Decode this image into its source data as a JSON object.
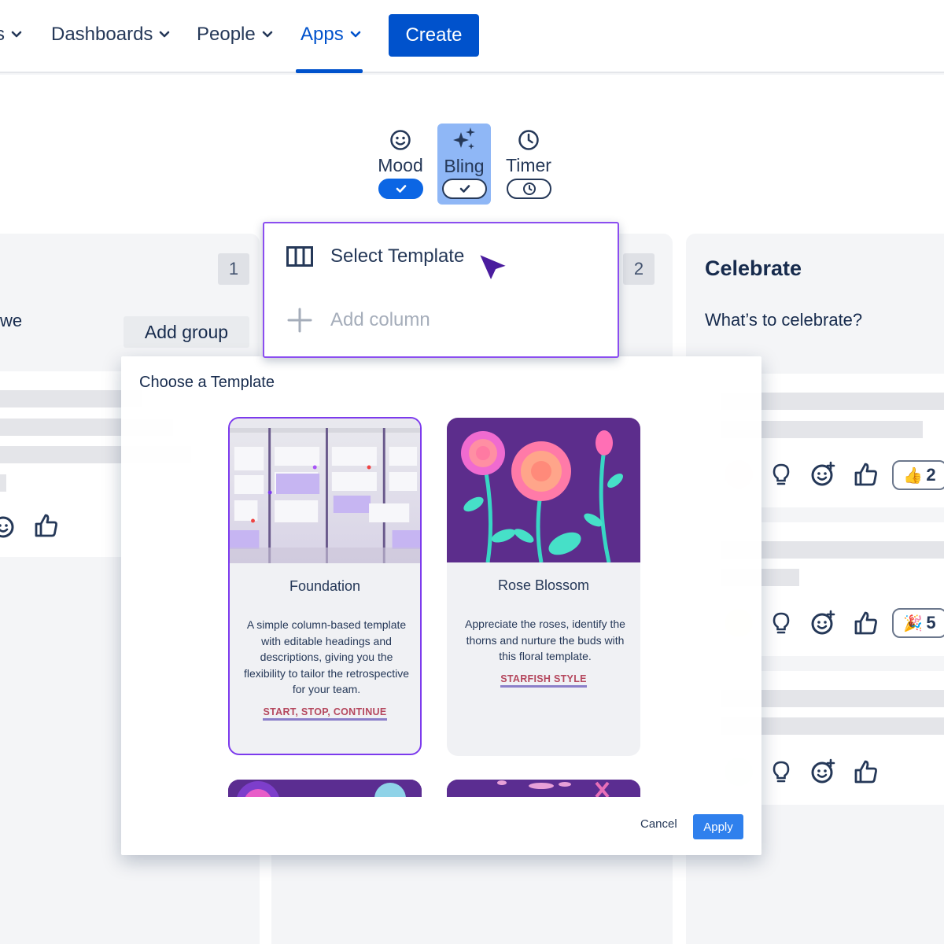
{
  "nav": {
    "items": [
      {
        "label": "s"
      },
      {
        "label": "Dashboards"
      },
      {
        "label": "People"
      },
      {
        "label": "Apps"
      }
    ],
    "create_label": "Create",
    "accent": "#0052cc"
  },
  "features": [
    {
      "label": "Mood",
      "icon": "smiley-icon",
      "state": "on"
    },
    {
      "label": "Bling",
      "icon": "sparkles-icon",
      "state": "checked"
    },
    {
      "label": "Timer",
      "icon": "clock-icon",
      "state": "timer"
    }
  ],
  "columns": {
    "left": {
      "count": "1",
      "subtitle": "we",
      "add_group_label": "Add group"
    },
    "middle": {
      "count": "2"
    },
    "right": {
      "title": "Celebrate",
      "subtitle": "What’s to celebrate?"
    }
  },
  "reactions": {
    "badge1": {
      "emoji": "👍",
      "count": "2"
    },
    "badge2": {
      "emoji": "🎉",
      "count": "5"
    }
  },
  "dropdown": {
    "select_template_label": "Select Template",
    "add_column_label": "Add column"
  },
  "modal": {
    "title": "Choose a Template",
    "templates": [
      {
        "name": "Foundation",
        "description": "A simple column-based template with editable headings and descriptions, giving you the flexibility to tailor the retrospective for your team.",
        "tag": "START, STOP, CONTINUE"
      },
      {
        "name": "Rose Blossom",
        "description": "Appreciate the roses, identify the thorns and nurture the buds with this floral template.",
        "tag": "STARFISH STYLE"
      }
    ],
    "cancel_label": "Cancel",
    "apply_label": "Apply"
  }
}
